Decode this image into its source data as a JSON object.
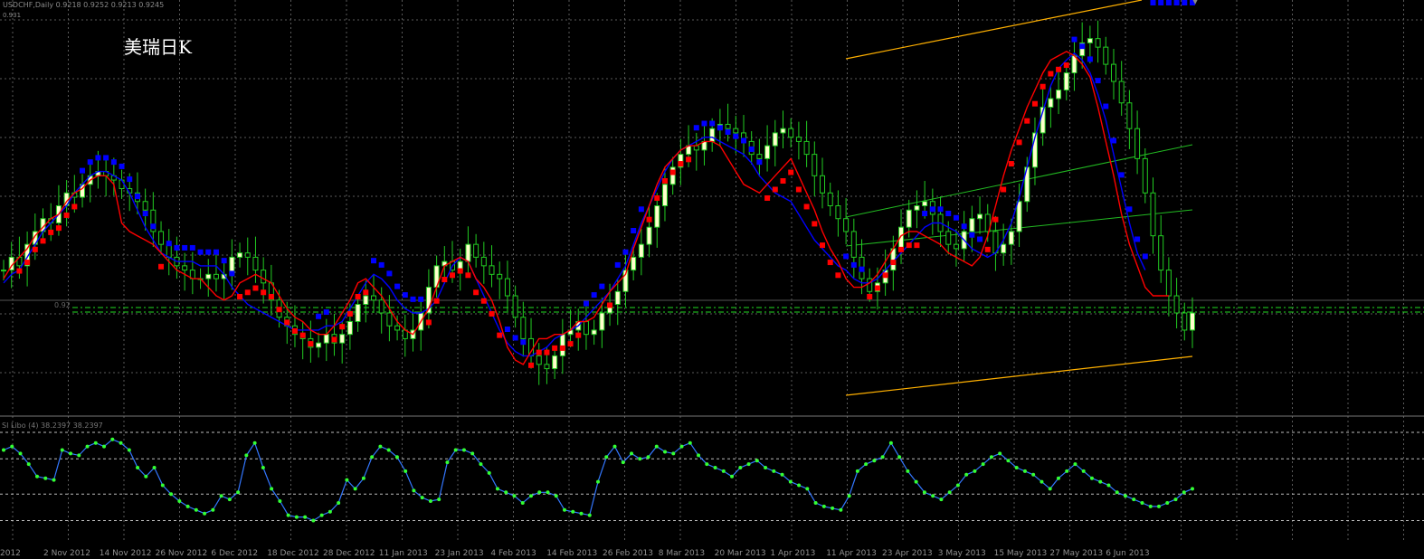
{
  "header": {
    "symbol_line": "USDCHF,Daily  0.9218 0.9252 0.9213 0.9245",
    "sub_line": "0.931",
    "overlay_title": "美瑞日K"
  },
  "price_panel": {
    "level_label": "0.92"
  },
  "indicator_panel": {
    "label": "SI Libo (4) 38.2397 38.2397"
  },
  "colors": {
    "background": "#000000",
    "grid": "#5a5a5a",
    "bull_candle": "#ffffcc",
    "candle_wick": "#22cc22",
    "fast_line": "#ff0000",
    "slow_line": "#0000ff",
    "dots_up": "#ff0000",
    "dots_down": "#0000ff",
    "channel": "#ffb000",
    "inner_channel": "#22bb22",
    "indicator_line": "#3377ff",
    "indicator_dot": "#33ff33",
    "level_line": "#22dd22",
    "date_label": "#909090"
  },
  "chart_data": {
    "type": "candlestick",
    "title": "",
    "x_ticks": [
      "2 Nov 2012",
      "14 Nov 2012",
      "26 Nov 2012",
      "6 Dec 2012",
      "18 Dec 2012",
      "28 Dec 2012",
      "11 Jan 2013",
      "23 Jan 2013",
      "4 Feb 2013",
      "14 Feb 2013",
      "26 Feb 2013",
      "8 Mar 2013",
      "20 Mar 2013",
      "1 Apr 2013",
      "11 Apr 2013",
      "23 Apr 2013",
      "3 May 2013",
      "15 May 2013",
      "27 May 2013",
      "6 Jun 2013"
    ],
    "first_tick_partial": "2012",
    "closes": [
      0.9295,
      0.931,
      0.93,
      0.9325,
      0.934,
      0.9355,
      0.935,
      0.937,
      0.9385,
      0.938,
      0.9395,
      0.9405,
      0.941,
      0.9405,
      0.94,
      0.939,
      0.9385,
      0.9375,
      0.9365,
      0.934,
      0.9325,
      0.931,
      0.93,
      0.9295,
      0.9285,
      0.9285,
      0.929,
      0.9285,
      0.929,
      0.931,
      0.9315,
      0.931,
      0.9295,
      0.928,
      0.926,
      0.924,
      0.923,
      0.922,
      0.9215,
      0.9205,
      0.921,
      0.922,
      0.921,
      0.922,
      0.9235,
      0.9255,
      0.9265,
      0.926,
      0.9245,
      0.923,
      0.9225,
      0.9215,
      0.9225,
      0.9245,
      0.9275,
      0.93,
      0.9305,
      0.9295,
      0.9305,
      0.9325,
      0.931,
      0.93,
      0.929,
      0.9285,
      0.9265,
      0.924,
      0.9215,
      0.9195,
      0.9185,
      0.918,
      0.9195,
      0.922,
      0.9225,
      0.9235,
      0.922,
      0.9225,
      0.9245,
      0.9255,
      0.927,
      0.9295,
      0.931,
      0.9325,
      0.9345,
      0.937,
      0.9395,
      0.9415,
      0.943,
      0.944,
      0.9435,
      0.9445,
      0.946,
      0.9465,
      0.946,
      0.9455,
      0.9445,
      0.943,
      0.9425,
      0.944,
      0.9455,
      0.946,
      0.945,
      0.9445,
      0.943,
      0.9405,
      0.9385,
      0.937,
      0.9355,
      0.934,
      0.931,
      0.9285,
      0.927,
      0.928,
      0.9295,
      0.932,
      0.9345,
      0.9365,
      0.937,
      0.9375,
      0.936,
      0.934,
      0.9325,
      0.932,
      0.934,
      0.9355,
      0.936,
      0.934,
      0.9315,
      0.9325,
      0.934,
      0.9375,
      0.9415,
      0.9455,
      0.9485,
      0.9495,
      0.9505,
      0.9525,
      0.9545,
      0.956,
      0.9565,
      0.9555,
      0.9535,
      0.9515,
      0.949,
      0.946,
      0.9425,
      0.9385,
      0.9335,
      0.9295,
      0.9265,
      0.9245,
      0.9225,
      0.9245
    ],
    "fast_line": [
      0.9285,
      0.93,
      0.931,
      0.932,
      0.9335,
      0.9345,
      0.9355,
      0.936,
      0.9375,
      0.9385,
      0.939,
      0.94,
      0.9405,
      0.9405,
      0.9395,
      0.935,
      0.934,
      0.9335,
      0.933,
      0.9325,
      0.9315,
      0.9305,
      0.9295,
      0.929,
      0.9285,
      0.9285,
      0.9275,
      0.9265,
      0.926,
      0.9265,
      0.928,
      0.9285,
      0.929,
      0.9285,
      0.928,
      0.9265,
      0.925,
      0.924,
      0.9235,
      0.9225,
      0.922,
      0.922,
      0.923,
      0.9245,
      0.926,
      0.928,
      0.9285,
      0.9275,
      0.9265,
      0.925,
      0.9235,
      0.9225,
      0.922,
      0.9235,
      0.925,
      0.9275,
      0.93,
      0.9305,
      0.931,
      0.9305,
      0.9285,
      0.9275,
      0.926,
      0.9235,
      0.9205,
      0.919,
      0.9185,
      0.92,
      0.9215,
      0.9215,
      0.922,
      0.922,
      0.9225,
      0.9235,
      0.9235,
      0.924,
      0.9255,
      0.927,
      0.928,
      0.929,
      0.932,
      0.9345,
      0.937,
      0.9395,
      0.9415,
      0.9425,
      0.9435,
      0.944,
      0.944,
      0.9445,
      0.9445,
      0.944,
      0.9425,
      0.941,
      0.9395,
      0.939,
      0.9385,
      0.9395,
      0.9405,
      0.9415,
      0.9425,
      0.9405,
      0.9385,
      0.9365,
      0.934,
      0.932,
      0.9305,
      0.9285,
      0.9275,
      0.9275,
      0.928,
      0.929,
      0.9305,
      0.932,
      0.9335,
      0.934,
      0.934,
      0.9335,
      0.933,
      0.9325,
      0.9315,
      0.931,
      0.9305,
      0.93,
      0.931,
      0.9335,
      0.937,
      0.9405,
      0.9435,
      0.946,
      0.9485,
      0.9505,
      0.9525,
      0.954,
      0.9545,
      0.955,
      0.9545,
      0.9535,
      0.952,
      0.9485,
      0.9445,
      0.9405,
      0.936,
      0.9325,
      0.93,
      0.9275,
      0.9265,
      0.9265,
      0.9265
    ],
    "slow_line": [
      0.928,
      0.929,
      0.9295,
      0.931,
      0.9325,
      0.934,
      0.935,
      0.936,
      0.937,
      0.9385,
      0.9395,
      0.9405,
      0.941,
      0.941,
      0.9405,
      0.94,
      0.9385,
      0.9365,
      0.9345,
      0.933,
      0.9315,
      0.931,
      0.9305,
      0.9305,
      0.9305,
      0.93,
      0.93,
      0.93,
      0.929,
      0.9275,
      0.9265,
      0.9255,
      0.925,
      0.9245,
      0.924,
      0.9235,
      0.923,
      0.9225,
      0.9225,
      0.9225,
      0.9225,
      0.923,
      0.923,
      0.9235,
      0.925,
      0.9265,
      0.928,
      0.929,
      0.9285,
      0.9275,
      0.926,
      0.925,
      0.9245,
      0.9245,
      0.925,
      0.926,
      0.928,
      0.93,
      0.931,
      0.9305,
      0.9285,
      0.9265,
      0.9245,
      0.9225,
      0.921,
      0.92,
      0.9195,
      0.9195,
      0.92,
      0.9205,
      0.9215,
      0.922,
      0.9225,
      0.923,
      0.924,
      0.925,
      0.926,
      0.927,
      0.9285,
      0.93,
      0.9325,
      0.935,
      0.937,
      0.939,
      0.941,
      0.9425,
      0.9435,
      0.944,
      0.9445,
      0.945,
      0.945,
      0.9445,
      0.944,
      0.9435,
      0.943,
      0.942,
      0.9405,
      0.9395,
      0.9385,
      0.938,
      0.9375,
      0.936,
      0.9345,
      0.933,
      0.932,
      0.931,
      0.93,
      0.9295,
      0.9285,
      0.928,
      0.928,
      0.9285,
      0.9295,
      0.9305,
      0.9315,
      0.9325,
      0.9335,
      0.9345,
      0.935,
      0.935,
      0.9345,
      0.934,
      0.933,
      0.932,
      0.9315,
      0.931,
      0.9315,
      0.933,
      0.935,
      0.938,
      0.9415,
      0.945,
      0.948,
      0.951,
      0.953,
      0.954,
      0.9548,
      0.954,
      0.9525,
      0.95,
      0.947,
      0.943,
      0.939,
      0.935,
      0.9315,
      0.9295
    ],
    "indicator_values": [
      70,
      72,
      68,
      62,
      55,
      54,
      53,
      70,
      68,
      67,
      72,
      74,
      72,
      76,
      74,
      70,
      60,
      55,
      60,
      50,
      45,
      41,
      38,
      36,
      34,
      36,
      44,
      42,
      46,
      67,
      74,
      60,
      48,
      41,
      33,
      32,
      32,
      30,
      33,
      35,
      40,
      53,
      48,
      54,
      66,
      72,
      70,
      66,
      58,
      47,
      43,
      41,
      42,
      63,
      70,
      70,
      68,
      62,
      57,
      48,
      46,
      44,
      40,
      44,
      46,
      46,
      44,
      36,
      35,
      34,
      33,
      52,
      66,
      72,
      63,
      68,
      65,
      66,
      72,
      69,
      68,
      72,
      74,
      67,
      62,
      60,
      58,
      55,
      60,
      62,
      64,
      60,
      58,
      56,
      52,
      50,
      48,
      40,
      38,
      37,
      36,
      44,
      58,
      62,
      64,
      66,
      74,
      66,
      58,
      52,
      46,
      44,
      42,
      46,
      50,
      56,
      58,
      62,
      66,
      68,
      64,
      60,
      58,
      56,
      52,
      48,
      54,
      58,
      62,
      58,
      54,
      52,
      50,
      46,
      44,
      42,
      40,
      38,
      38,
      40,
      42,
      46,
      48
    ],
    "indicator_levels": [
      80,
      65,
      45,
      30
    ],
    "ylim": [
      0.913,
      0.961
    ]
  }
}
